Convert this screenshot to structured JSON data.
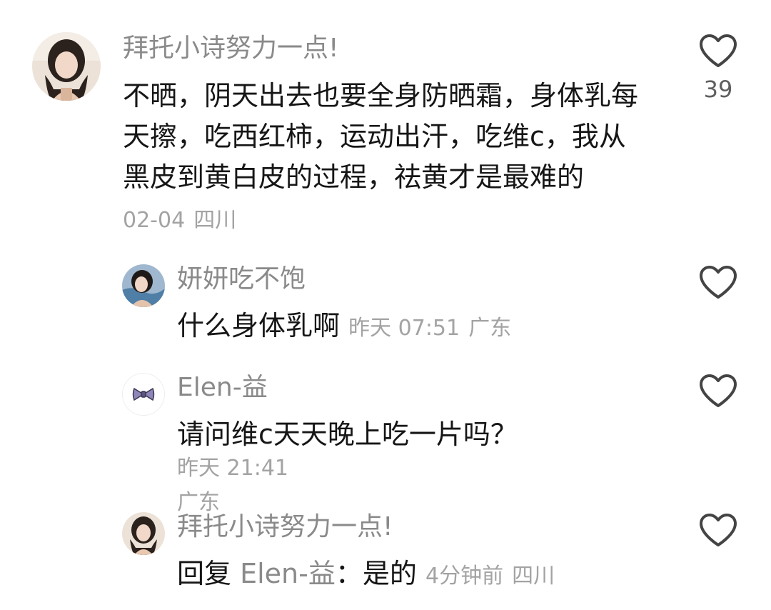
{
  "comments": [
    {
      "author": "拜托小诗努力一点!",
      "text": "不晒，阴天出去也要全身防晒霜，身体乳每天擦，吃西红柿，运动出汗，吃维c，我从黑皮到黄白皮的过程，祛黄才是最难的",
      "time": "02-04",
      "location": "四川",
      "like_count": "39",
      "avatar_icon": "user-avatar-photo"
    },
    {
      "author": "妍妍吃不饱",
      "text": "什么身体乳啊",
      "time": "昨天 07:51",
      "location": "广东",
      "avatar_icon": "user-avatar-photo"
    },
    {
      "author": "Elen-益",
      "text": "请问维c天天晚上吃一片吗？",
      "time": "昨天 21:41",
      "location": "广东",
      "avatar_icon": "bow-avatar-icon"
    },
    {
      "author": "拜托小诗努力一点!",
      "reply_prefix": "回复",
      "reply_target": "Elen-益",
      "reply_separator": "：",
      "text": "是的",
      "time": "4分钟前",
      "location": "四川",
      "avatar_icon": "user-avatar-photo"
    }
  ],
  "colors": {
    "author": "#8a8a8a",
    "meta": "#a3a3a3",
    "text": "#161616",
    "heart_outline": "#444444"
  },
  "icons": {
    "like": "heart-outline-icon"
  }
}
